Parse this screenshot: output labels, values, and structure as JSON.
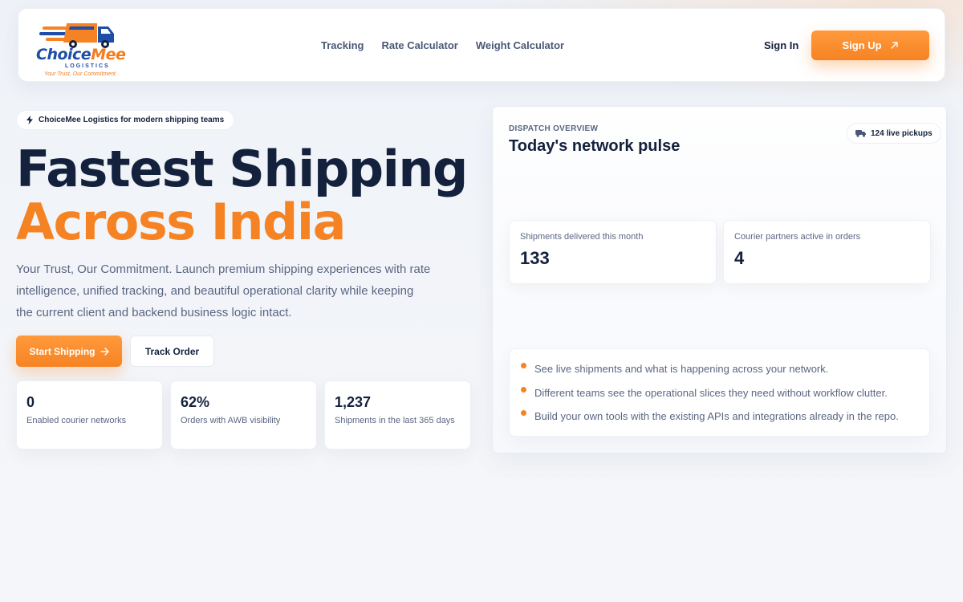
{
  "brand": {
    "name_part1": "Choice",
    "name_part2": "Mee",
    "subtitle": "LOGISTICS",
    "tagline": "Your Trust, Our Commitment",
    "colors": {
      "primary": "#14213d",
      "accent": "#f68323",
      "brand_blue": "#1e4ea8"
    }
  },
  "nav": {
    "items": [
      {
        "label": "Tracking"
      },
      {
        "label": "Rate Calculator"
      },
      {
        "label": "Weight Calculator"
      }
    ],
    "signin_label": "Sign In",
    "signup_label": "Sign Up",
    "signup_icon": "arrow-up-right-icon"
  },
  "hero": {
    "badge_icon": "lightning-icon",
    "badge_text": "ChoiceMee Logistics for modern shipping teams",
    "title_line1": "Fastest Shipping",
    "title_line2": "Across India",
    "description": "Your Trust, Our Commitment. Launch premium shipping experiences with rate intelligence, unified tracking, and beautiful operational clarity while keeping the current client and backend business logic intact.",
    "cta_primary": "Start Shipping",
    "cta_primary_icon": "arrow-right-icon",
    "cta_secondary": "Track Order",
    "stats": [
      {
        "value": "0",
        "label": "Enabled courier networks"
      },
      {
        "value": "62%",
        "label": "Orders with AWB visibility"
      },
      {
        "value": "1,237",
        "label": "Shipments in the last 365 days"
      }
    ]
  },
  "dispatch": {
    "eyebrow": "DISPATCH OVERVIEW",
    "title": "Today's network pulse",
    "live_icon": "truck-icon",
    "live_text": "124 live pickups",
    "metrics": [
      {
        "label": "Shipments delivered this month",
        "value": "133"
      },
      {
        "label": "Courier partners active in orders",
        "value": "4"
      }
    ],
    "bullets": [
      "See live shipments and what is happening across your network.",
      "Different teams see the operational slices they need without workflow clutter.",
      "Build your own tools with the existing APIs and integrations already in the repo."
    ]
  }
}
